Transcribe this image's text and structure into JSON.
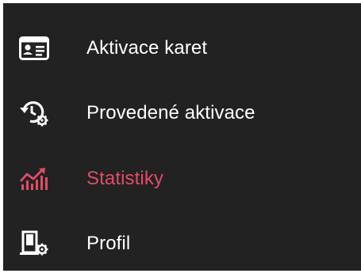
{
  "menu": {
    "items": [
      {
        "label": "Aktivace karet",
        "icon": "id-card-icon",
        "active": false
      },
      {
        "label": "Provedené aktivace",
        "icon": "history-settings-icon",
        "active": false
      },
      {
        "label": "Statistiky",
        "icon": "chart-icon",
        "active": true
      },
      {
        "label": "Profil",
        "icon": "profile-settings-icon",
        "active": false
      }
    ]
  },
  "colors": {
    "background": "#222222",
    "text": "#ffffff",
    "accent": "#e34b68"
  }
}
